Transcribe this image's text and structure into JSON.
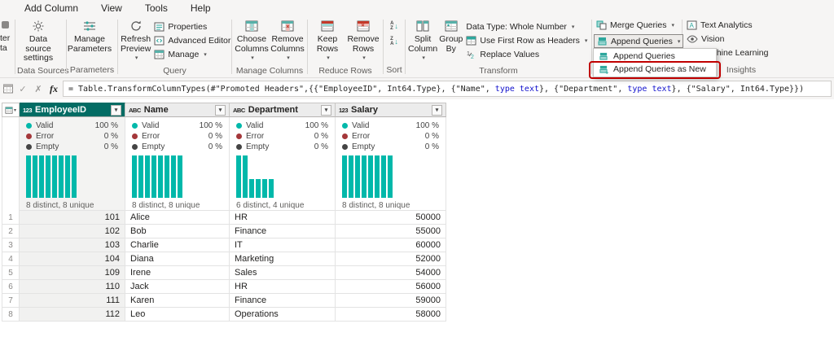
{
  "menubar": {
    "add_column": "Add Column",
    "view": "View",
    "tools": "Tools",
    "help": "Help"
  },
  "ribbon": {
    "partial": {
      "line1": "ter",
      "line2": "ta"
    },
    "data_sources": {
      "button": "Data source settings",
      "label": "Data Sources"
    },
    "parameters": {
      "button": "Manage Parameters",
      "label": "Parameters"
    },
    "query": {
      "refresh": "Refresh Preview",
      "properties": "Properties",
      "advanced_editor": "Advanced Editor",
      "manage": "Manage",
      "label": "Query"
    },
    "manage_columns": {
      "choose": "Choose Columns",
      "remove": "Remove Columns",
      "label": "Manage Columns"
    },
    "reduce_rows": {
      "keep": "Keep Rows",
      "remove": "Remove Rows",
      "label": "Reduce Rows"
    },
    "sort": {
      "label": "Sort"
    },
    "transform": {
      "split": "Split Column",
      "group_by": "Group By",
      "data_type": "Data Type: Whole Number",
      "first_row": "Use First Row as Headers",
      "replace": "Replace Values",
      "label": "Transform"
    },
    "combine": {
      "merge": "Merge Queries",
      "append": "Append Queries"
    },
    "ai": {
      "text_analytics": "Text Analytics",
      "vision": "Vision",
      "machine_learning": "Machine Learning",
      "label": "Insights"
    }
  },
  "append_menu": {
    "item1": "Append Queries",
    "item2": "Append Queries as New"
  },
  "formula_bar": {
    "fx": "fx",
    "seg1": "= Table.TransformColumnTypes(#\"Promoted Headers\",{{\"EmployeeID\", Int64.Type}, {\"Name\", ",
    "seg2": "type text",
    "seg3": "}, {\"Department\", ",
    "seg4": "type text",
    "seg5": "}, {\"Salary\", Int64.Type}})"
  },
  "table": {
    "quality_labels": {
      "valid": "Valid",
      "error": "Error",
      "empty": "Empty"
    },
    "columns": [
      {
        "type_icon": "123",
        "name": "EmployeeID",
        "valid": "100 %",
        "error": "0 %",
        "empty": "0 %",
        "hist": [
          1,
          1,
          1,
          1,
          1,
          1,
          1,
          1
        ],
        "distinct": "8 distinct, 8 unique"
      },
      {
        "type_icon": "ABC",
        "name": "Name",
        "valid": "100 %",
        "error": "0 %",
        "empty": "0 %",
        "hist": [
          1,
          1,
          1,
          1,
          1,
          1,
          1,
          1
        ],
        "distinct": "8 distinct, 8 unique"
      },
      {
        "type_icon": "ABC",
        "name": "Department",
        "valid": "100 %",
        "error": "0 %",
        "empty": "0 %",
        "hist": [
          1,
          1,
          0.45,
          0.45,
          0.45,
          0.45
        ],
        "distinct": "6 distinct, 4 unique"
      },
      {
        "type_icon": "123",
        "name": "Salary",
        "valid": "100 %",
        "error": "0 %",
        "empty": "0 %",
        "hist": [
          1,
          1,
          1,
          1,
          1,
          1,
          1,
          1
        ],
        "distinct": "8 distinct, 8 unique"
      }
    ],
    "rows": [
      {
        "n": "1",
        "id": "101",
        "name": "Alice",
        "dept": "HR",
        "salary": "50000"
      },
      {
        "n": "2",
        "id": "102",
        "name": "Bob",
        "dept": "Finance",
        "salary": "55000"
      },
      {
        "n": "3",
        "id": "103",
        "name": "Charlie",
        "dept": "IT",
        "salary": "60000"
      },
      {
        "n": "4",
        "id": "104",
        "name": "Diana",
        "dept": "Marketing",
        "salary": "52000"
      },
      {
        "n": "5",
        "id": "109",
        "name": "Irene",
        "dept": "Sales",
        "salary": "54000"
      },
      {
        "n": "6",
        "id": "110",
        "name": "Jack",
        "dept": "HR",
        "salary": "56000"
      },
      {
        "n": "7",
        "id": "111",
        "name": "Karen",
        "dept": "Finance",
        "salary": "59000"
      },
      {
        "n": "8",
        "id": "112",
        "name": "Leo",
        "dept": "Operations",
        "salary": "58000"
      }
    ]
  },
  "colors": {
    "teal": "#01b8aa",
    "teal_dark": "#036c64",
    "annotation_red": "#c00000"
  }
}
